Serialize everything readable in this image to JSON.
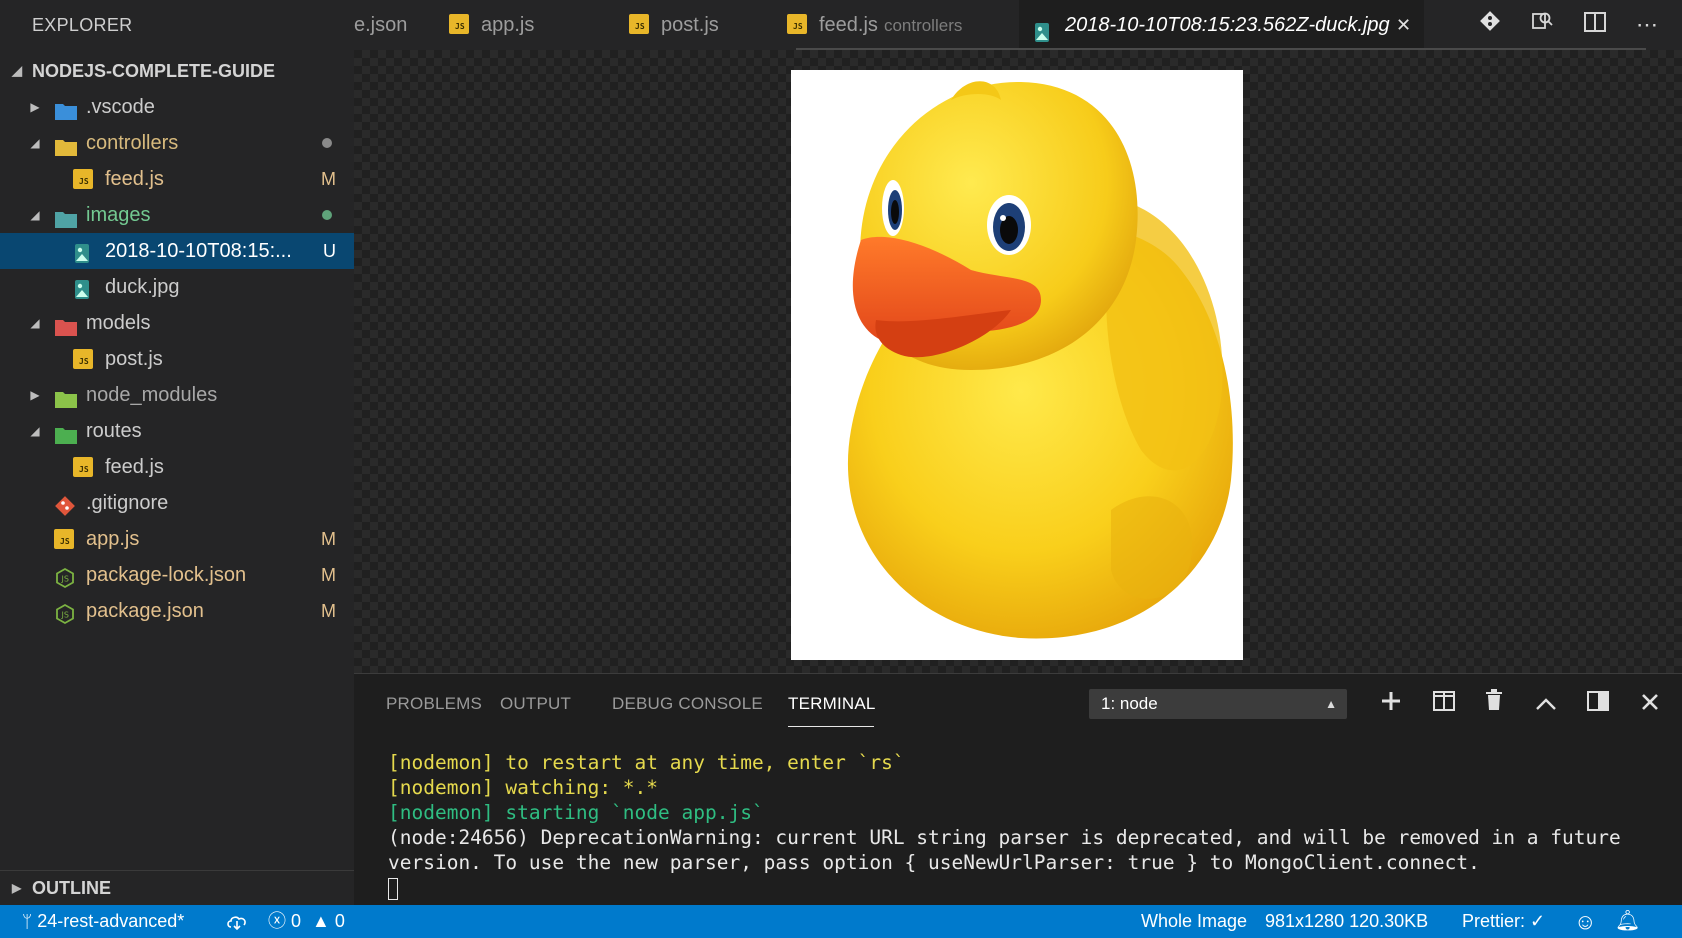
{
  "sidebar": {
    "header": "EXPLORER",
    "project": "NODEJS-COMPLETE-GUIDE",
    "outline": "OUTLINE",
    "tree": [
      {
        "label": ".vscode",
        "kind": "folder",
        "color": "#3b8fd9",
        "expanded": false,
        "depth": 0,
        "badge": "",
        "labelColor": "#cccccc"
      },
      {
        "label": "controllers",
        "kind": "folder",
        "color": "#e2b93b",
        "expanded": true,
        "depth": 0,
        "badge": "",
        "labelColor": "#d7ba7d",
        "dot": "#8a8a8a"
      },
      {
        "label": "feed.js",
        "kind": "js",
        "depth": 1,
        "badge": "M",
        "labelColor": "#e2c08d"
      },
      {
        "label": "images",
        "kind": "folder",
        "color": "#4fa3a5",
        "expanded": true,
        "depth": 0,
        "badge": "",
        "labelColor": "#73c991",
        "dot": "#5fa37a"
      },
      {
        "label": "2018-10-10T08:15:...",
        "kind": "image",
        "depth": 1,
        "badge": "U",
        "labelColor": "#ffffff",
        "selected": true
      },
      {
        "label": "duck.jpg",
        "kind": "image",
        "depth": 1,
        "badge": "",
        "labelColor": "#cccccc"
      },
      {
        "label": "models",
        "kind": "folder",
        "color": "#d9534f",
        "expanded": true,
        "depth": 0,
        "badge": "",
        "labelColor": "#cccccc"
      },
      {
        "label": "post.js",
        "kind": "js",
        "depth": 1,
        "badge": "",
        "labelColor": "#cccccc"
      },
      {
        "label": "node_modules",
        "kind": "folder",
        "color": "#8bc34a",
        "expanded": false,
        "depth": 0,
        "badge": "",
        "labelColor": "#a8a8a8"
      },
      {
        "label": "routes",
        "kind": "folder",
        "color": "#4caf50",
        "expanded": true,
        "depth": 0,
        "badge": "",
        "labelColor": "#cccccc"
      },
      {
        "label": "feed.js",
        "kind": "js",
        "depth": 1,
        "badge": "",
        "labelColor": "#cccccc"
      },
      {
        "label": ".gitignore",
        "kind": "git",
        "depth": 0,
        "badge": "",
        "labelColor": "#cccccc"
      },
      {
        "label": "app.js",
        "kind": "js",
        "depth": 0,
        "badge": "M",
        "labelColor": "#e2c08d"
      },
      {
        "label": "package-lock.json",
        "kind": "npm",
        "depth": 0,
        "badge": "M",
        "labelColor": "#e2c08d"
      },
      {
        "label": "package.json",
        "kind": "npm",
        "depth": 0,
        "badge": "M",
        "labelColor": "#e2c08d"
      }
    ]
  },
  "tabs": [
    {
      "label": "e.json",
      "desc": "",
      "kind": "none",
      "active": false
    },
    {
      "label": "app.js",
      "desc": "",
      "kind": "js",
      "active": false
    },
    {
      "label": "post.js",
      "desc": "",
      "kind": "js",
      "active": false
    },
    {
      "label": "feed.js",
      "desc": "controllers",
      "kind": "js",
      "active": false
    },
    {
      "label": "2018-10-10T08:15:23.562Z-duck.jpg",
      "desc": "",
      "kind": "image",
      "active": true
    }
  ],
  "tab_close_glyph": "✕",
  "editor_actions": {
    "git": "git-compare-icon",
    "preview": "open-preview-icon",
    "split": "split-editor-icon",
    "more": "⋯"
  },
  "panel": {
    "tabs": [
      "PROBLEMS",
      "OUTPUT",
      "DEBUG CONSOLE",
      "TERMINAL"
    ],
    "active_tab": "TERMINAL",
    "terminal_select": "1: node",
    "terminal_lines": [
      {
        "text": "[nodemon] to restart at any time, enter `rs`",
        "color": "y"
      },
      {
        "text": "[nodemon] watching: *.*",
        "color": "y"
      },
      {
        "text": "[nodemon] starting `node app.js`",
        "color": "g"
      },
      {
        "text": "(node:24656) DeprecationWarning: current URL string parser is deprecated, and will be removed in a future",
        "color": "w"
      },
      {
        "text": "version. To use the new parser, pass option { useNewUrlParser: true } to MongoClient.connect.",
        "color": "w"
      }
    ]
  },
  "statusbar": {
    "branch": "24-rest-advanced*",
    "errors": "0",
    "warnings": "0",
    "view_mode": "Whole Image",
    "image_info": "981x1280 120.30KB",
    "prettier": "Prettier: ✓"
  },
  "colors": {
    "accent": "#007acc",
    "selection": "#094771",
    "js_badge": "#e8b629",
    "modified": "#e2c08d",
    "untracked": "#73c991"
  }
}
